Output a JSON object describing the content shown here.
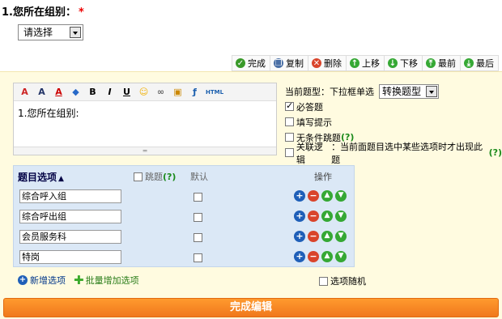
{
  "question": {
    "title": "1.您所在组别：",
    "required_mark": "*"
  },
  "preview_select": {
    "value": "请选择"
  },
  "toolbar": [
    {
      "label": "完成",
      "icon": "check-icon",
      "color": "#3a9a2a"
    },
    {
      "label": "复制",
      "icon": "copy-icon",
      "color": "#4a6fa5"
    },
    {
      "label": "删除",
      "icon": "delete-icon",
      "color": "#d9442b"
    },
    {
      "label": "上移",
      "icon": "up-icon",
      "color": "#35a834"
    },
    {
      "label": "下移",
      "icon": "down-icon",
      "color": "#35a834"
    },
    {
      "label": "最前",
      "icon": "top-icon",
      "color": "#35a834"
    },
    {
      "label": "最后",
      "icon": "bottom-icon",
      "color": "#35a834"
    }
  ],
  "editor": {
    "content": "1.您所在组别:"
  },
  "side": {
    "type_label": "当前题型：下拉框单选",
    "convert_value": "转换题型",
    "required": "必答题",
    "fill_hint": "填写提示",
    "no_cond_jump": "无条件跳题",
    "relation_logic": "关联逻辑",
    "relation_desc": "：当前面题目选中某些选项时才出现此题",
    "help": "(?)"
  },
  "options": {
    "title": "题目选项",
    "jump": "跳题",
    "help": "(?)",
    "default": "默认",
    "op": "操作",
    "items": [
      "综合呼入组",
      "综合呼出组",
      "会员服务科",
      "特岗"
    ]
  },
  "links": {
    "add_option": "新增选项",
    "batch_add": "批量增加选项",
    "random": "选项随机"
  },
  "finish_label": "完成编辑"
}
